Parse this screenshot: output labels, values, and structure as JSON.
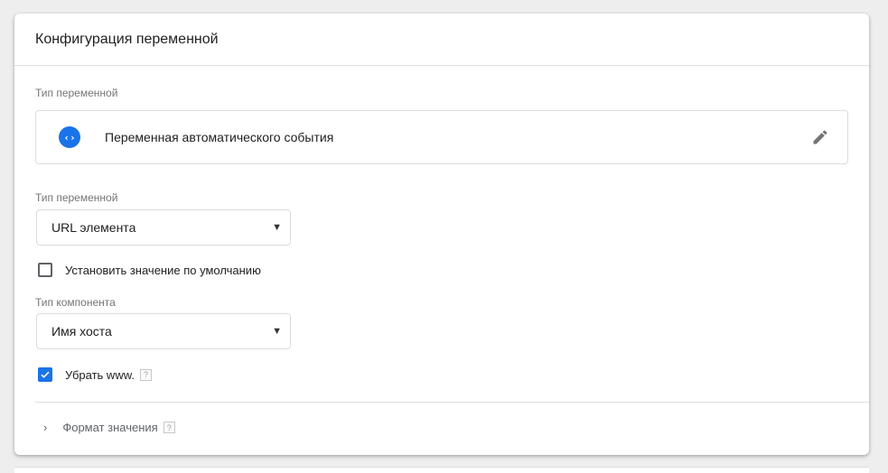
{
  "card": {
    "title": "Конфигурация переменной"
  },
  "variable_type_section": {
    "label": "Тип переменной",
    "type_name": "Переменная автоматического события",
    "type_icon": "code-brackets-icon",
    "edit_icon": "pencil-icon"
  },
  "variable_subtype": {
    "label": "Тип переменной",
    "selected": "URL элемента"
  },
  "default_value_checkbox": {
    "label": "Установить значение по умолчанию",
    "checked": false
  },
  "component_type": {
    "label": "Тип компонента",
    "selected": "Имя хоста"
  },
  "strip_www_checkbox": {
    "label": "Убрать www.",
    "checked": true,
    "help": "?"
  },
  "format_value": {
    "label": "Формат значения",
    "help": "?"
  },
  "colors": {
    "accent": "#1a73e8",
    "background": "#eeeeee"
  }
}
